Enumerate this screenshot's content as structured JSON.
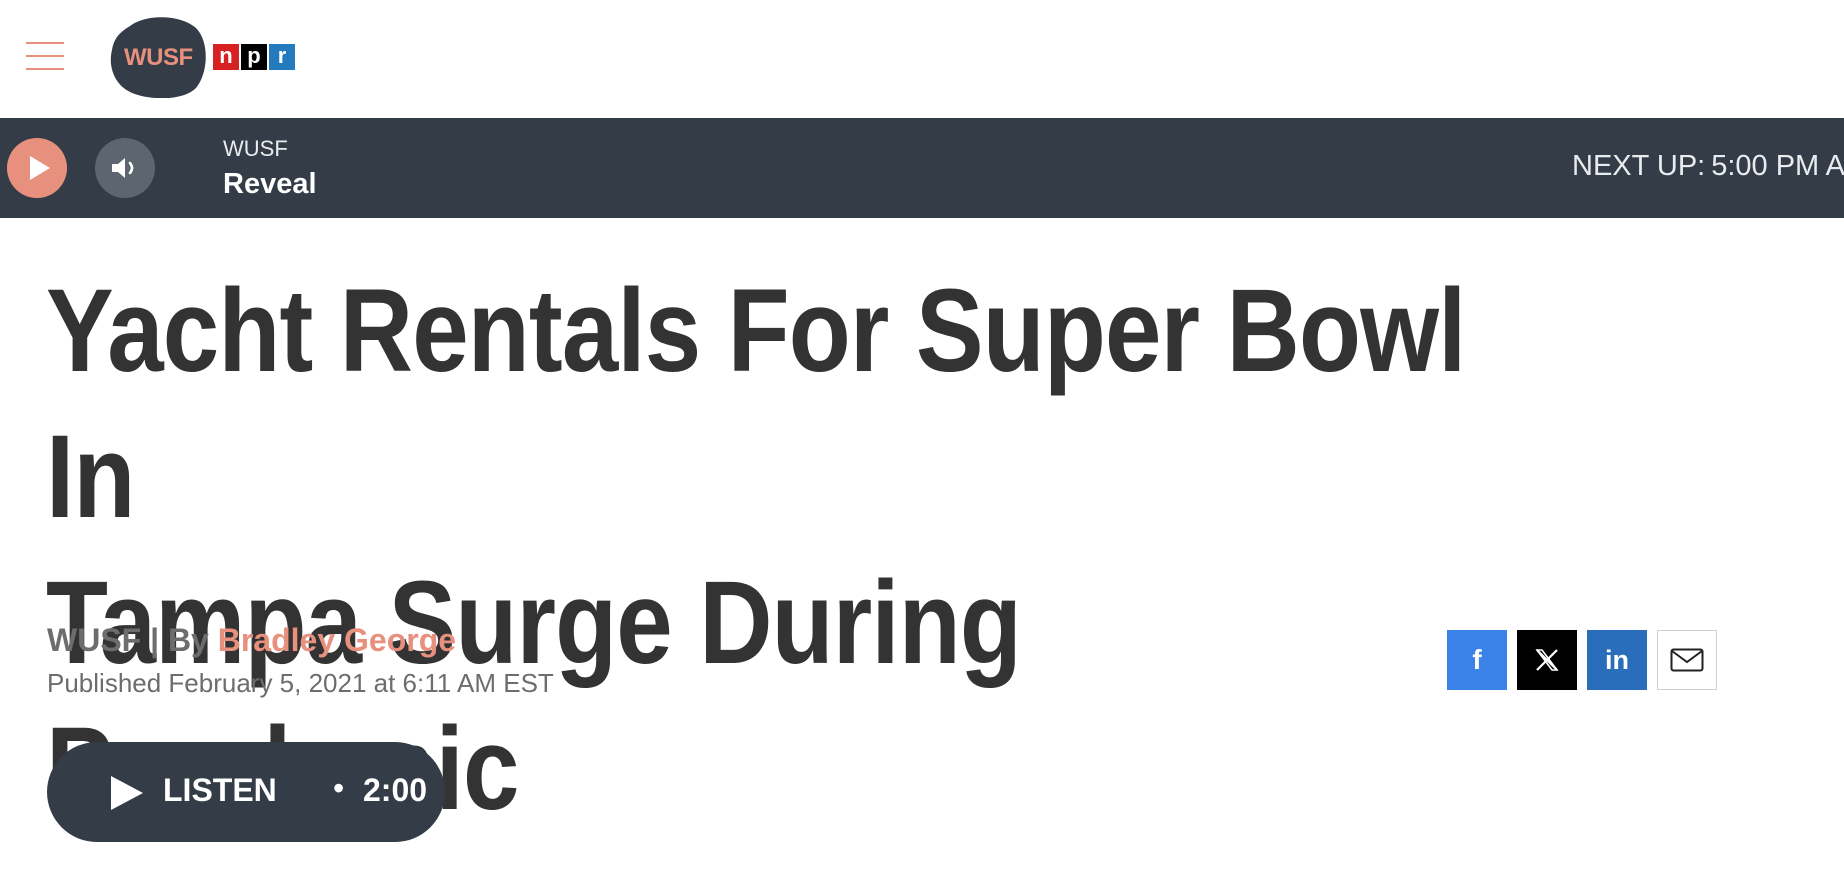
{
  "header": {
    "logo_text": "WUSF",
    "npr_letters": [
      "n",
      "p",
      "r"
    ]
  },
  "player": {
    "station": "WUSF",
    "show": "Reveal",
    "next_up_label": "NEXT UP:",
    "next_up_value": "5:00 PM A"
  },
  "article": {
    "headline_line1": "Yacht Rentals For Super Bowl In",
    "headline_line2": "Tampa Surge During Pandemic",
    "source": "WUSF",
    "by_separator": " | By ",
    "author": "Bradley George",
    "published": "Published February 5, 2021 at 6:11 AM EST"
  },
  "listen": {
    "label": "LISTEN",
    "separator": "•",
    "duration": "2:00"
  },
  "share": {
    "facebook_glyph": "f",
    "linkedin_glyph": "in"
  },
  "colors": {
    "accent": "#e8907e",
    "player_bg": "#343d47",
    "headline": "#333333",
    "facebook": "#3b82e8",
    "linkedin": "#2a6ebb",
    "npr_n": "#d62021",
    "npr_p": "#000000",
    "npr_r": "#237bbd"
  },
  "icons": [
    "hamburger-menu-icon",
    "play-icon",
    "volume-icon",
    "facebook-icon",
    "x-icon",
    "linkedin-icon",
    "email-icon"
  ]
}
